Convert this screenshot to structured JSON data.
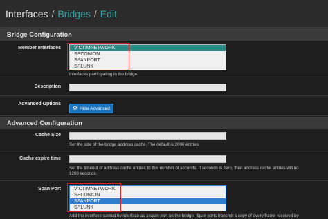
{
  "breadcrumb": {
    "items": [
      "Interfaces",
      "Bridges",
      "Edit"
    ],
    "separator": "/"
  },
  "sections": {
    "bridge_config": "Bridge Configuration",
    "advanced_config": "Advanced Configuration"
  },
  "member_interfaces": {
    "label": "Member Interfaces",
    "options": [
      "VICTIMNETWORK",
      "SECONION",
      "SPANPORT",
      "SPLUNK"
    ],
    "selected": "VICTIMNETWORK",
    "help": "Interfaces participating in the bridge."
  },
  "description": {
    "label": "Description",
    "value": ""
  },
  "advanced_options": {
    "label": "Advanced Options",
    "button": "Hide Advanced"
  },
  "cache_size": {
    "label": "Cache Size",
    "value": "",
    "help": "Set the size of the bridge address cache. The default is 2000 entries."
  },
  "cache_expire": {
    "label": "Cache expire time",
    "value": "",
    "help_line1": "Set the timeout of address cache entries to this number of seconds. If seconds is zero, then address cache entries will no",
    "help_line2": "1200 seconds."
  },
  "span_port": {
    "label": "Span Port",
    "options": [
      "VICTIMNETWORK",
      "SECONION",
      "SPANPORT",
      "SPLUNK"
    ],
    "selected": "SPANPORT",
    "help": "Add the interface named by interface as a span port on the bridge. Span ports transmit a copy of every frame received by"
  },
  "colors": {
    "link": "#2ea1a5",
    "selected_teal": "#2a8a86",
    "selected_blue": "#2f7fd1",
    "button": "#1a74c0",
    "highlight_box": "#e0201e"
  }
}
